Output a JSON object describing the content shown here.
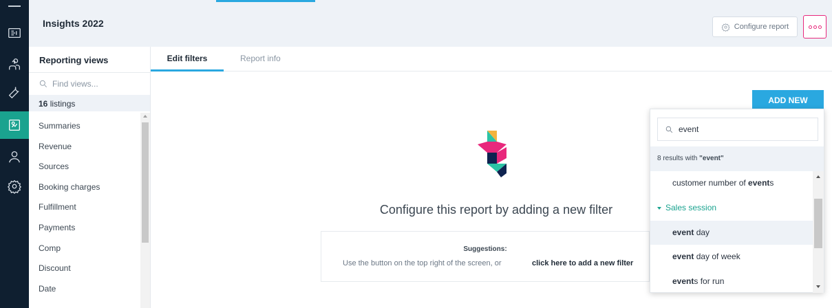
{
  "header": {
    "title": "Insights 2022",
    "configure_label": "Configure report",
    "configure_icon": "gear-icon",
    "more_icon": "more-dots-icon"
  },
  "rail": {
    "items": [
      "ticket-icon",
      "team-icon",
      "wrench-icon",
      "reports-icon",
      "user-icon",
      "gear-icon"
    ],
    "active": "reports-icon"
  },
  "sidebar": {
    "heading": "Reporting views",
    "search_placeholder": "Find views...",
    "count_number": "16",
    "count_suffix": " listings",
    "items": [
      "Summaries",
      "Revenue",
      "Sources",
      "Booking charges",
      "Fulfillment",
      "Payments",
      "Comp",
      "Discount",
      "Date"
    ]
  },
  "tabs": {
    "edit": "Edit filters",
    "info": "Report info"
  },
  "main": {
    "add_new": "ADD NEW",
    "empty_message": "Configure this report by adding a new filter",
    "suggestions_heading": "Suggestions:",
    "suggestions_text": "Use the button on the top right of the screen, or",
    "suggestions_link": "click here to add a new filter"
  },
  "dropdown": {
    "query": "event",
    "results_prefix": "8 results with ",
    "results_query": "\"event\"",
    "rows": [
      {
        "type": "item",
        "pre": "customer number of ",
        "match": "event",
        "post": "s"
      },
      {
        "type": "group",
        "label": "Sales session"
      },
      {
        "type": "item",
        "pre": "",
        "match": "event",
        "post": " day",
        "highlight": true
      },
      {
        "type": "item",
        "pre": "",
        "match": "event",
        "post": " day of week"
      },
      {
        "type": "item",
        "pre": "",
        "match": "event",
        "post": "s for run"
      }
    ]
  },
  "colors": {
    "accent": "#2aa8e0",
    "rail": "#0f1f30",
    "active_rail": "#1aa38f",
    "more_border": "#e8287c"
  }
}
